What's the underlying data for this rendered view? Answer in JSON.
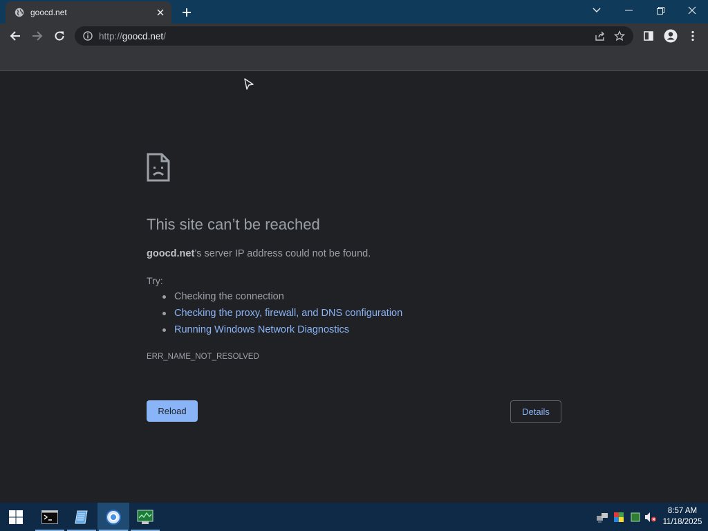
{
  "browser": {
    "tab_title": "goocd.net",
    "url_prefix": "http://",
    "url_host": "goocd.net",
    "url_suffix": "/"
  },
  "error": {
    "title": "This site can’t be reached",
    "host": "goocd.net",
    "description_rest": "’s server IP address could not be found.",
    "try_label": "Try:",
    "suggestions": [
      "Checking the connection",
      "Checking the proxy, firewall, and DNS configuration",
      "Running Windows Network Diagnostics"
    ],
    "code": "ERR_NAME_NOT_RESOLVED",
    "reload_label": "Reload",
    "details_label": "Details"
  },
  "taskbar": {
    "time": "8:57 AM",
    "date": "11/18/2025",
    "apps": [
      "terminal-icon",
      "notepad-icon",
      "chrome-icon",
      "task-manager-icon"
    ]
  },
  "colors": {
    "page_bg": "#202124",
    "link": "#8ab4f8",
    "taskbar": "#0e2a47",
    "titlebar": "#0f3a5a"
  }
}
